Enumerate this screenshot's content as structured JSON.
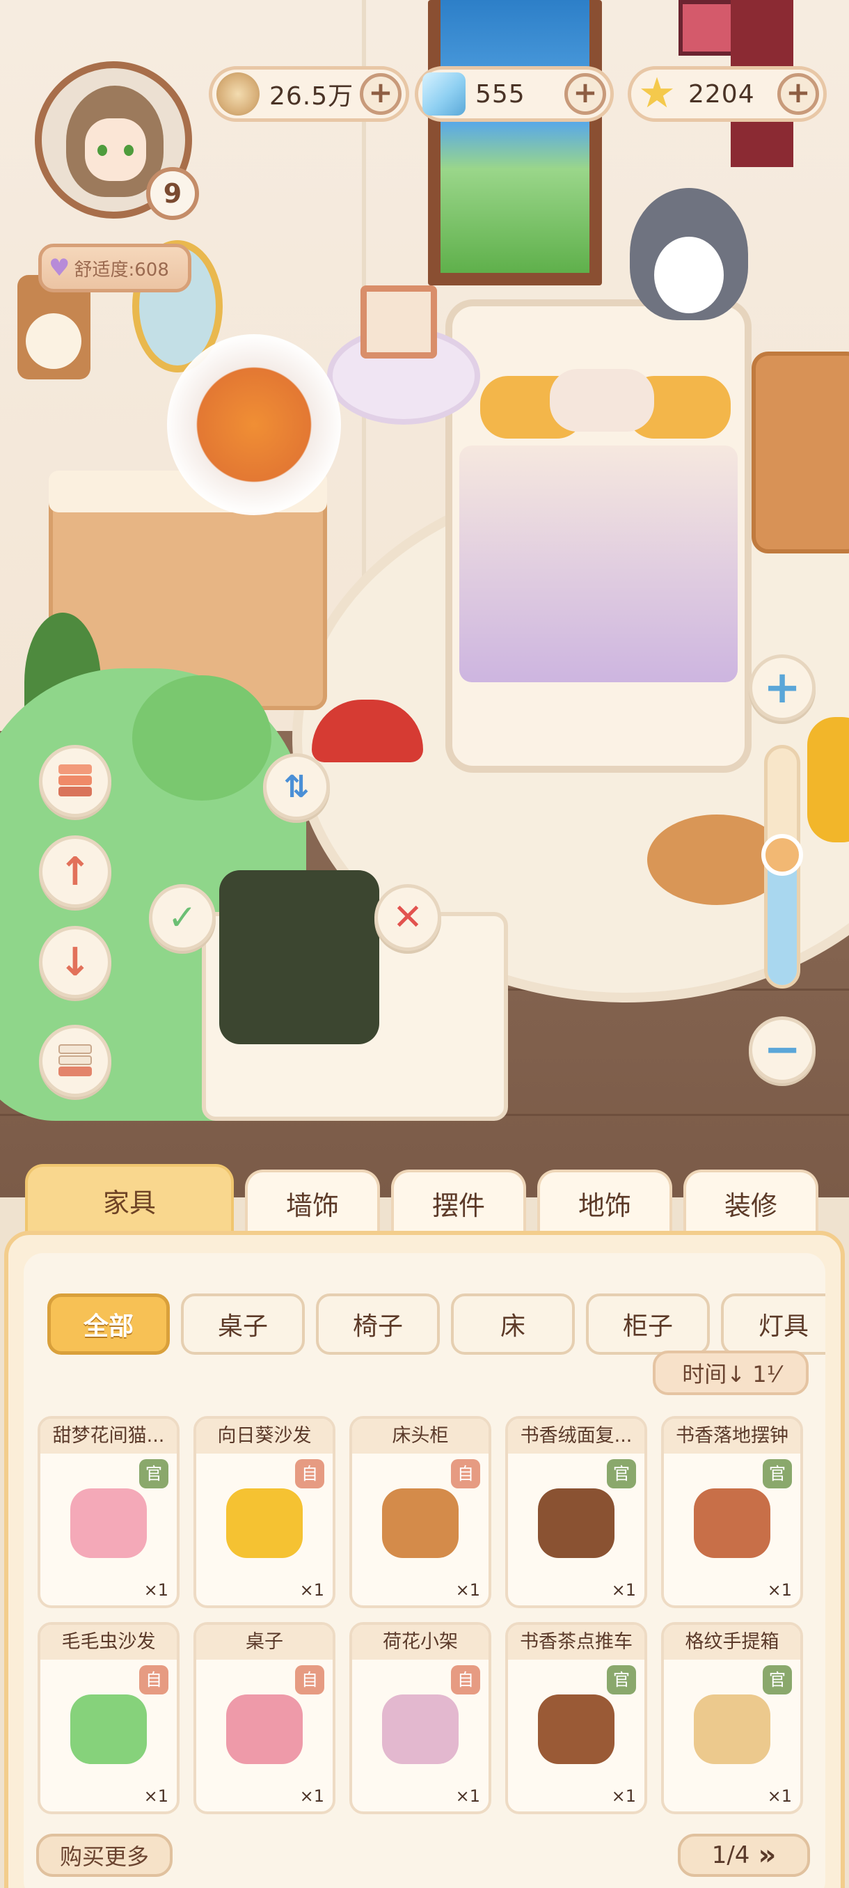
{
  "hud": {
    "level": "9",
    "comfort_label": "舒适度:608",
    "resources": [
      {
        "icon": "coin-icon",
        "value": "26.5万",
        "color": "#d8b07a"
      },
      {
        "icon": "crystal-icon",
        "value": "555",
        "color": "#8fd0f2"
      },
      {
        "icon": "star-icon",
        "value": "2204",
        "color": "#f4c94c"
      }
    ],
    "plus": "+"
  },
  "edit_controls": {
    "confirm_icon": "check-icon",
    "cancel_icon": "close-icon",
    "flip_icon": "flip-icon",
    "layer_up_icon": "arrow-up-icon",
    "layer_down_icon": "arrow-down-icon",
    "zoom_in": "+",
    "zoom_out": "−",
    "zoom_level": 0.55
  },
  "tabs": [
    "家具",
    "墙饰",
    "摆件",
    "地饰",
    "装修"
  ],
  "active_tab": 0,
  "categories": [
    "全部",
    "桌子",
    "椅子",
    "床",
    "柜子",
    "灯具"
  ],
  "active_category": 0,
  "sort_label": "时间↓ 1⅟",
  "items": [
    {
      "name": "甜梦花间猫...",
      "tag": "官",
      "tag_type": "g",
      "qty": "×1",
      "color": "#f4a9b8"
    },
    {
      "name": "向日葵沙发",
      "tag": "自",
      "tag_type": "r",
      "qty": "×1",
      "color": "#f5c232"
    },
    {
      "name": "床头柜",
      "tag": "自",
      "tag_type": "r",
      "qty": "×1",
      "color": "#d48b4a"
    },
    {
      "name": "书香绒面复...",
      "tag": "官",
      "tag_type": "g",
      "qty": "×1",
      "color": "#8a5232"
    },
    {
      "name": "书香落地摆钟",
      "tag": "官",
      "tag_type": "g",
      "qty": "×1",
      "color": "#c86f48"
    },
    {
      "name": "毛毛虫沙发",
      "tag": "自",
      "tag_type": "r",
      "qty": "×1",
      "color": "#86d27b"
    },
    {
      "name": "桌子",
      "tag": "自",
      "tag_type": "r",
      "qty": "×1",
      "color": "#ee9aa9"
    },
    {
      "name": "荷花小架",
      "tag": "自",
      "tag_type": "r",
      "qty": "×1",
      "color": "#e3b8cf"
    },
    {
      "name": "书香茶点推车",
      "tag": "官",
      "tag_type": "g",
      "qty": "×1",
      "color": "#9a5a36"
    },
    {
      "name": "格纹手提箱",
      "tag": "官",
      "tag_type": "g",
      "qty": "×1",
      "color": "#ecc98d"
    }
  ],
  "buy_more": "购买更多",
  "pager": {
    "text": "1/4",
    "next_icon": "double-chevron-right-icon"
  }
}
